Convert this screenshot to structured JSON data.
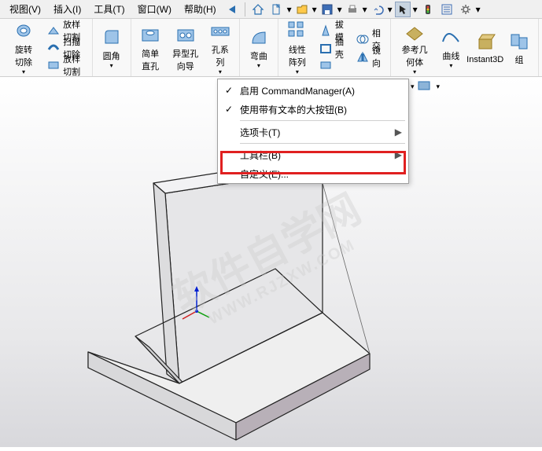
{
  "menubar": {
    "items": [
      "视图(V)",
      "插入(I)",
      "工具(T)",
      "窗口(W)",
      "帮助(H)"
    ]
  },
  "ribbon": {
    "g1": {
      "big": "旋转切除",
      "sm": [
        "放样切割",
        "扫描切除",
        "放样切割"
      ]
    },
    "g2": {
      "fillet": "圆角"
    },
    "g3": {
      "simple": "简单直孔",
      "wizard": "异型孔向导",
      "series": "孔系列"
    },
    "g5": {
      "bend": "弯曲"
    },
    "g6": {
      "pattern": "线性阵列",
      "draft": "拔模",
      "shell": "抽壳",
      "intersect": "相交",
      "mirror": "镜向"
    },
    "g7": {
      "refgeo": "参考几何体",
      "curves": "曲线",
      "instant": "Instant3D",
      "comb": "组"
    }
  },
  "context": {
    "enable_cm": "启用 CommandManager(A)",
    "large_buttons": "使用带有文本的大按钮(B)",
    "tabs": "选项卡(T)",
    "toolbars": "工具栏(B)",
    "customize": "自定义(E)..."
  },
  "watermark": {
    "main": "软件自学网",
    "sub": "WWW.RJZXW.COM"
  }
}
